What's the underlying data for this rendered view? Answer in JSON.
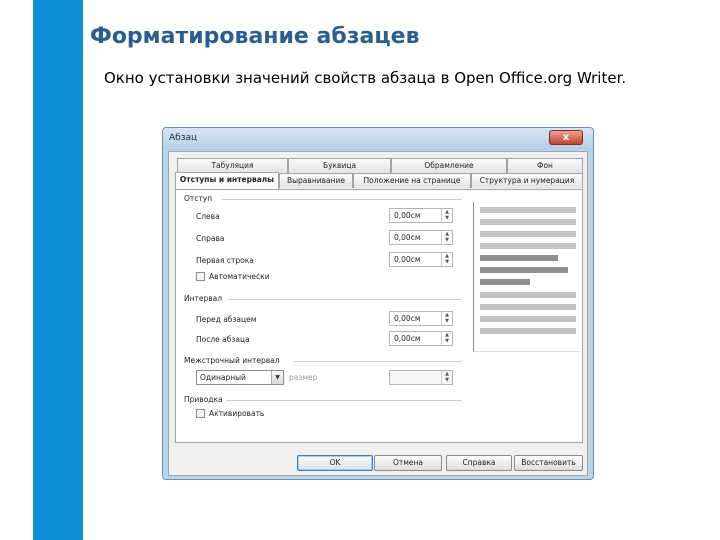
{
  "slide": {
    "title": "Форматирование абзацев",
    "subtitle": "Окно установки значений свойств абзаца в Open Office.org Writer."
  },
  "dialog": {
    "title": "Абзац",
    "close_label": "x",
    "tabs_row1": [
      "Табуляция",
      "Буквица",
      "Обрамление",
      "Фон"
    ],
    "tabs_row2": [
      "Отступы и интервалы",
      "Выравнивание",
      "Положение на странице",
      "Структура и нумерация"
    ],
    "active_tab": "Отступы и интервалы",
    "indent": {
      "group_label": "Отступ",
      "left_label": "Слева",
      "left_value": "0,00см",
      "right_label": "Справа",
      "right_value": "0,00см",
      "first_line_label": "Первая строка",
      "first_line_value": "0,00см",
      "auto_label": "Автоматически",
      "auto_checked": false
    },
    "spacing": {
      "group_label": "Интервал",
      "before_label": "Перед абзацем",
      "before_value": "0,00см",
      "after_label": "После абзаца",
      "after_value": "0,00см"
    },
    "line_spacing": {
      "group_label": "Межстрочный интервал",
      "selected": "Одинарный",
      "size_label": "размер",
      "size_value": ""
    },
    "register": {
      "group_label": "Приводка",
      "activate_label": "Активировать",
      "activate_checked": false
    },
    "buttons": {
      "ok": "OK",
      "cancel": "Отмена",
      "help": "Справка",
      "reset": "Восстановить"
    },
    "spin_up": "▲",
    "spin_down": "▼",
    "dropdown_arrow": "▼"
  },
  "colors": {
    "side_bar": "#0e8fd8",
    "title": "#2b5d8f",
    "preview_dark": "#8f8f8f",
    "preview_light": "#c4c4c4"
  }
}
